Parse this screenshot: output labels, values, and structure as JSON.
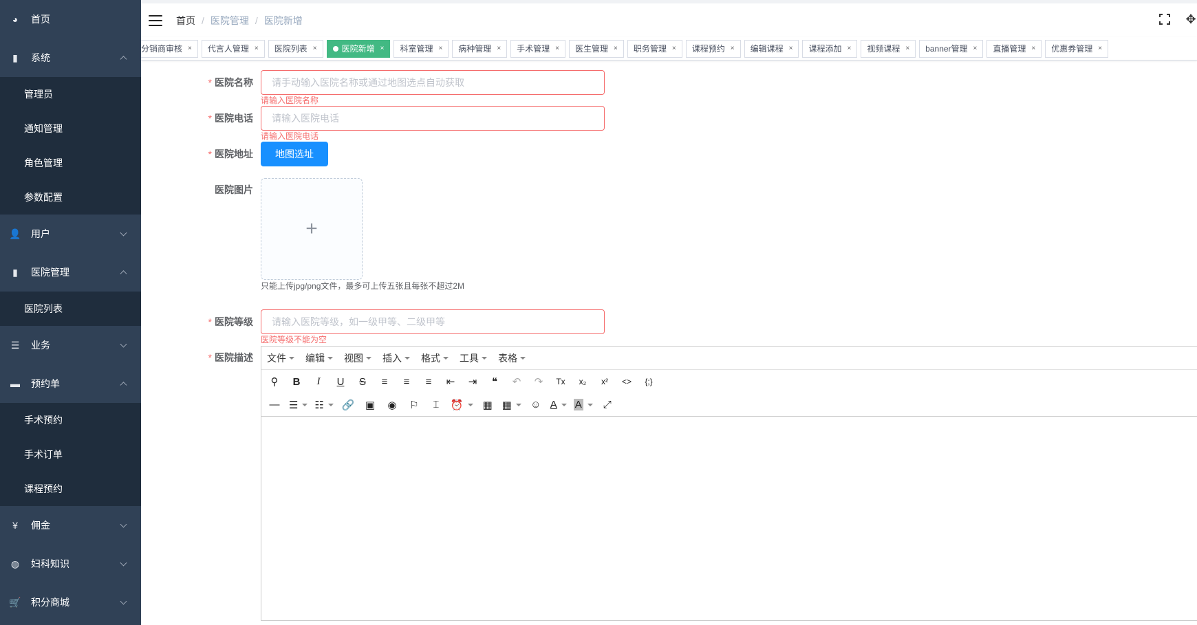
{
  "sidebar": {
    "items": [
      {
        "label": "首页",
        "icon": "dashboard-icon"
      },
      {
        "label": "系统",
        "icon": "bar-chart-icon",
        "expanded": true,
        "children": [
          {
            "label": "管理员"
          },
          {
            "label": "通知管理"
          },
          {
            "label": "角色管理"
          },
          {
            "label": "参数配置"
          }
        ]
      },
      {
        "label": "用户",
        "icon": "user-icon",
        "expanded": false
      },
      {
        "label": "医院管理",
        "icon": "bar-chart-icon",
        "expanded": true,
        "children": [
          {
            "label": "医院列表"
          }
        ]
      },
      {
        "label": "业务",
        "icon": "list-icon",
        "expanded": false
      },
      {
        "label": "预约单",
        "icon": "comment-icon",
        "expanded": true,
        "children": [
          {
            "label": "手术预约"
          },
          {
            "label": "手术订单"
          },
          {
            "label": "课程预约"
          }
        ]
      },
      {
        "label": "佣金",
        "icon": "yen-icon",
        "expanded": false
      },
      {
        "label": "妇科知识",
        "icon": "globe-icon",
        "expanded": false
      },
      {
        "label": "积分商城",
        "icon": "cart-icon",
        "expanded": false
      }
    ]
  },
  "header": {
    "breadcrumb": [
      "首页",
      "医院管理",
      "医院新增"
    ],
    "breadcrumb_sep": "/"
  },
  "tags": [
    {
      "label": "分销商审核",
      "active": false
    },
    {
      "label": "代言人管理",
      "active": false
    },
    {
      "label": "医院列表",
      "active": false
    },
    {
      "label": "医院新增",
      "active": true
    },
    {
      "label": "科室管理",
      "active": false
    },
    {
      "label": "病种管理",
      "active": false
    },
    {
      "label": "手术管理",
      "active": false
    },
    {
      "label": "医生管理",
      "active": false
    },
    {
      "label": "职务管理",
      "active": false
    },
    {
      "label": "课程预约",
      "active": false
    },
    {
      "label": "编辑课程",
      "active": false
    },
    {
      "label": "课程添加",
      "active": false
    },
    {
      "label": "视频课程",
      "active": false
    },
    {
      "label": "banner管理",
      "active": false
    },
    {
      "label": "直播管理",
      "active": false
    },
    {
      "label": "优惠券管理",
      "active": false
    }
  ],
  "tag_close": "×",
  "form": {
    "required_mark": "*",
    "name": {
      "label": "医院名称",
      "placeholder": "请手动输入医院名称或通过地图选点自动获取",
      "error": "请输入医院名称",
      "value": ""
    },
    "phone": {
      "label": "医院电话",
      "placeholder": "请输入医院电话",
      "error": "请输入医院电话",
      "value": ""
    },
    "address": {
      "label": "医院地址",
      "button": "地图选址"
    },
    "image": {
      "label": "医院图片",
      "plus": "+",
      "tip": "只能上传jpg/png文件，最多可上传五张且每张不超过2M"
    },
    "level": {
      "label": "医院等级",
      "placeholder": "请输入医院等级，如一级甲等、二级甲等",
      "error": "医院等级不能为空",
      "value": ""
    },
    "desc": {
      "label": "医院描述"
    }
  },
  "editor": {
    "menus": [
      "文件",
      "编辑",
      "视图",
      "插入",
      "格式",
      "工具",
      "表格"
    ],
    "toolbar_row1": [
      {
        "name": "find-replace-icon",
        "glyph": "⚲"
      },
      {
        "name": "bold-icon",
        "glyph": "B"
      },
      {
        "name": "italic-icon",
        "glyph": "I"
      },
      {
        "name": "underline-icon",
        "glyph": "U"
      },
      {
        "name": "strikethrough-icon",
        "glyph": "S"
      },
      {
        "name": "align-left-icon",
        "glyph": "≡"
      },
      {
        "name": "align-center-icon",
        "glyph": "≡"
      },
      {
        "name": "align-right-icon",
        "glyph": "≡"
      },
      {
        "name": "outdent-icon",
        "glyph": "⇤"
      },
      {
        "name": "indent-icon",
        "glyph": "⇥"
      },
      {
        "name": "blockquote-icon",
        "glyph": "❝"
      },
      {
        "name": "undo-icon",
        "glyph": "↶"
      },
      {
        "name": "redo-icon",
        "glyph": "↷"
      },
      {
        "name": "clear-format-icon",
        "glyph": "Tx"
      },
      {
        "name": "subscript-icon",
        "glyph": "x₂"
      },
      {
        "name": "superscript-icon",
        "glyph": "x²"
      },
      {
        "name": "code-icon",
        "glyph": "<>"
      },
      {
        "name": "code-block-icon",
        "glyph": "{;}"
      }
    ],
    "toolbar_row2": [
      {
        "name": "horizontal-rule-icon",
        "glyph": "—",
        "dropdown": false
      },
      {
        "name": "bullet-list-icon",
        "glyph": "☰",
        "dropdown": true
      },
      {
        "name": "numbered-list-icon",
        "glyph": "☷",
        "dropdown": true
      },
      {
        "name": "link-icon",
        "glyph": "🔗",
        "dropdown": false
      },
      {
        "name": "image-icon",
        "glyph": "▣",
        "dropdown": false
      },
      {
        "name": "preview-icon",
        "glyph": "◉",
        "dropdown": false
      },
      {
        "name": "bookmark-icon",
        "glyph": "⚐",
        "dropdown": false
      },
      {
        "name": "page-break-icon",
        "glyph": "⌶",
        "dropdown": false
      },
      {
        "name": "date-time-icon",
        "glyph": "⏰",
        "dropdown": true
      },
      {
        "name": "media-icon",
        "glyph": "▦",
        "dropdown": false
      },
      {
        "name": "table-icon",
        "glyph": "▦",
        "dropdown": true
      },
      {
        "name": "emoji-icon",
        "glyph": "☺",
        "dropdown": false
      },
      {
        "name": "text-color-icon",
        "glyph": "A",
        "dropdown": true
      },
      {
        "name": "background-color-icon",
        "glyph": "A",
        "dropdown": true
      },
      {
        "name": "fullscreen-icon",
        "glyph": "⤢",
        "dropdown": false
      }
    ]
  },
  "colors": {
    "sidebar_bg": "#304156",
    "submenu_bg": "#1f2d3d",
    "active_tag": "#42b983",
    "primary_button": "#1890ff",
    "error": "#f56c6c"
  }
}
